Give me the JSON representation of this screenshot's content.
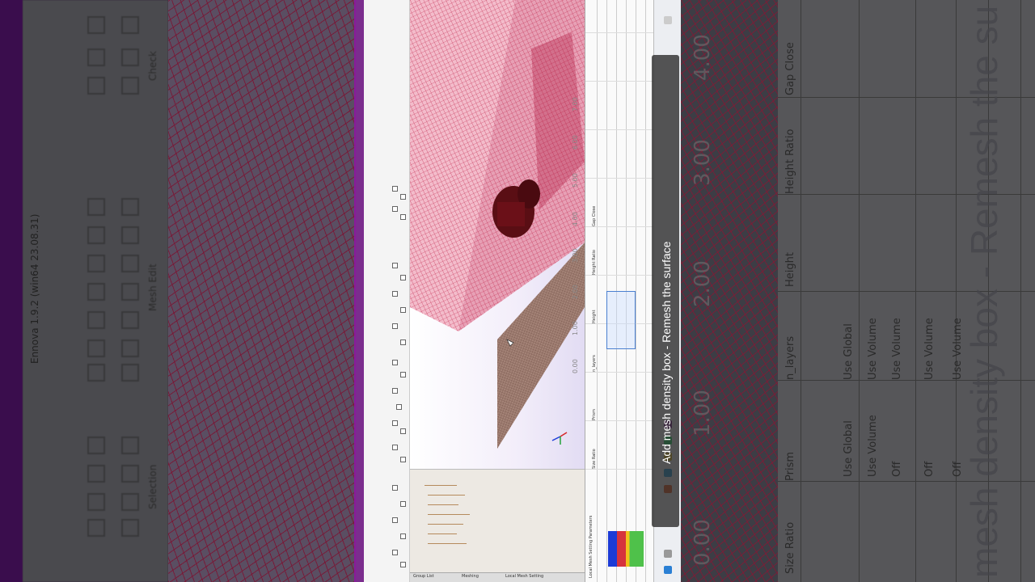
{
  "app": {
    "title": "Ennova 1.9.2 (win64 23.08.31)"
  },
  "ribbon": {
    "groups": [
      "Check",
      "Mesh Edit",
      "Selection"
    ]
  },
  "viewport": {
    "axis_ticks": [
      "0.00",
      "1.00",
      "2.00",
      "3.00",
      "4.00",
      "5.00",
      "6.00",
      "7.00"
    ],
    "triad_icon": "axis-triad-icon"
  },
  "tree": {
    "tabs": [
      "Group List",
      "Meshing",
      "Local Mesh Setting"
    ]
  },
  "panel": {
    "title": "Local Mesh Setting Parameters",
    "columns": [
      "Size Ratio",
      "Prism",
      "n_layers",
      "Height",
      "Height Ratio",
      "Gap Close"
    ],
    "rows": [
      {
        "prism": "Use Global",
        "n_layers": "Use Global"
      },
      {
        "prism": "Use Volume",
        "n_layers": "Use Volume"
      },
      {
        "prism": "Off",
        "n_layers": "Use Volume"
      },
      {
        "prism": "Off",
        "n_layers": "Use Volume"
      },
      {
        "prism": "Off",
        "n_layers": "Use Volume"
      }
    ]
  },
  "background_right": {
    "axis_numbers": [
      "0.00",
      "1.00",
      "2.00",
      "3.00",
      "4.00"
    ]
  },
  "caption": {
    "text": "Add mesh density box - Remesh the surface",
    "big_text": "mesh density box - Remesh the su"
  },
  "colors": {
    "mesh": "#b0183f",
    "taskbar": "#7b2d8e",
    "caption_bg": "#282828"
  }
}
